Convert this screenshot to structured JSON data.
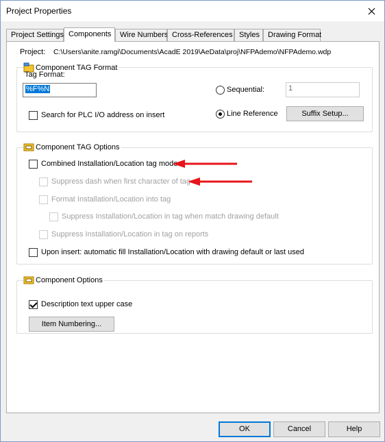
{
  "window": {
    "title": "Project Properties"
  },
  "tabs": [
    {
      "label": "Project Settings"
    },
    {
      "label": "Components"
    },
    {
      "label": "Wire Numbers"
    },
    {
      "label": "Cross-References"
    },
    {
      "label": "Styles"
    },
    {
      "label": "Drawing Format"
    }
  ],
  "project": {
    "label": "Project:",
    "path": "C:\\Users\\anite.ramgi\\Documents\\AcadE 2019\\AeData\\proj\\NFPAdemo\\NFPAdemo.wdp"
  },
  "tag_format_group": {
    "legend": "Component TAG Format",
    "tag_format_label": "Tag Format:",
    "tag_format_value": "%F%N",
    "sequential_label": "Sequential:",
    "sequential_value": "1",
    "line_reference_label": "Line Reference",
    "suffix_setup_label": "Suffix Setup...",
    "plc_search_label": "Search for PLC I/O address on insert"
  },
  "tag_options_group": {
    "legend": "Component TAG Options",
    "combined_label": "Combined Installation/Location tag mode",
    "suppress_dash_label": "Suppress dash when first character of tag",
    "format_inst_label": "Format Installation/Location into tag",
    "suppress_match_label": "Suppress Installation/Location in tag when match drawing default",
    "suppress_reports_label": "Suppress Installation/Location in tag on reports",
    "upon_insert_label": "Upon insert: automatic fill Installation/Location with drawing default or last used"
  },
  "component_options_group": {
    "legend": "Component Options",
    "description_upper_label": "Description text upper case",
    "item_numbering_label": "Item Numbering..."
  },
  "buttons": {
    "ok": "OK",
    "cancel": "Cancel",
    "help": "Help"
  },
  "colors": {
    "accent": "#0078d7",
    "annotation_arrow": "#e8141b"
  }
}
